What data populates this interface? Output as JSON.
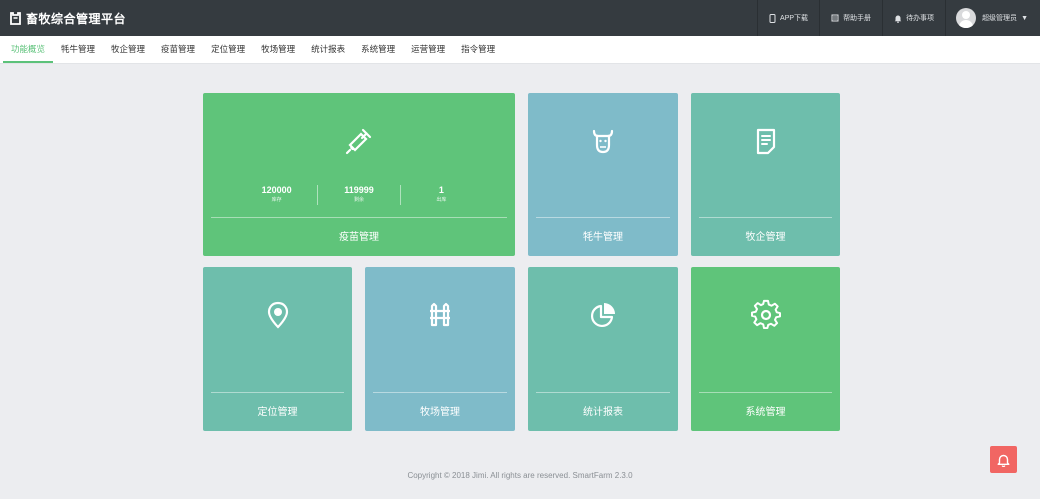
{
  "header": {
    "brand_title": "畜牧综合管理平台",
    "app_download": "APP下载",
    "help_manual": "帮助手册",
    "todo": "待办事项",
    "user_name": "超级管理员"
  },
  "nav": {
    "items": [
      {
        "label": "功能概览",
        "active": true
      },
      {
        "label": "牦牛管理"
      },
      {
        "label": "牧企管理"
      },
      {
        "label": "疫苗管理"
      },
      {
        "label": "定位管理"
      },
      {
        "label": "牧场管理"
      },
      {
        "label": "统计报表"
      },
      {
        "label": "系统管理"
      },
      {
        "label": "运营管理"
      },
      {
        "label": "指令管理"
      }
    ]
  },
  "tiles": {
    "vaccine": {
      "label": "疫苗管理",
      "icon": "syringe-icon",
      "stats": [
        {
          "value": "120000",
          "label": "库存"
        },
        {
          "value": "119999",
          "label": "剩余"
        },
        {
          "value": "1",
          "label": "出库"
        }
      ]
    },
    "yak": {
      "label": "牦牛管理",
      "icon": "yak-icon"
    },
    "enterprise": {
      "label": "牧企管理",
      "icon": "document-icon"
    },
    "location": {
      "label": "定位管理",
      "icon": "location-pin-icon"
    },
    "ranch": {
      "label": "牧场管理",
      "icon": "fence-icon"
    },
    "stats": {
      "label": "统计报表",
      "icon": "pie-chart-icon"
    },
    "system": {
      "label": "系统管理",
      "icon": "gear-icon"
    }
  },
  "footer": {
    "copyright": "Copyright © 2018 Jimi. All rights are reserved. SmartFarm 2.3.0"
  },
  "colors": {
    "header_bg": "#353b40",
    "accent_green": "#5cc27a",
    "tile_green": "#5fc47a",
    "tile_blue": "#7fbbc9",
    "tile_teal": "#6ebeac",
    "alert_red": "#f16663"
  }
}
